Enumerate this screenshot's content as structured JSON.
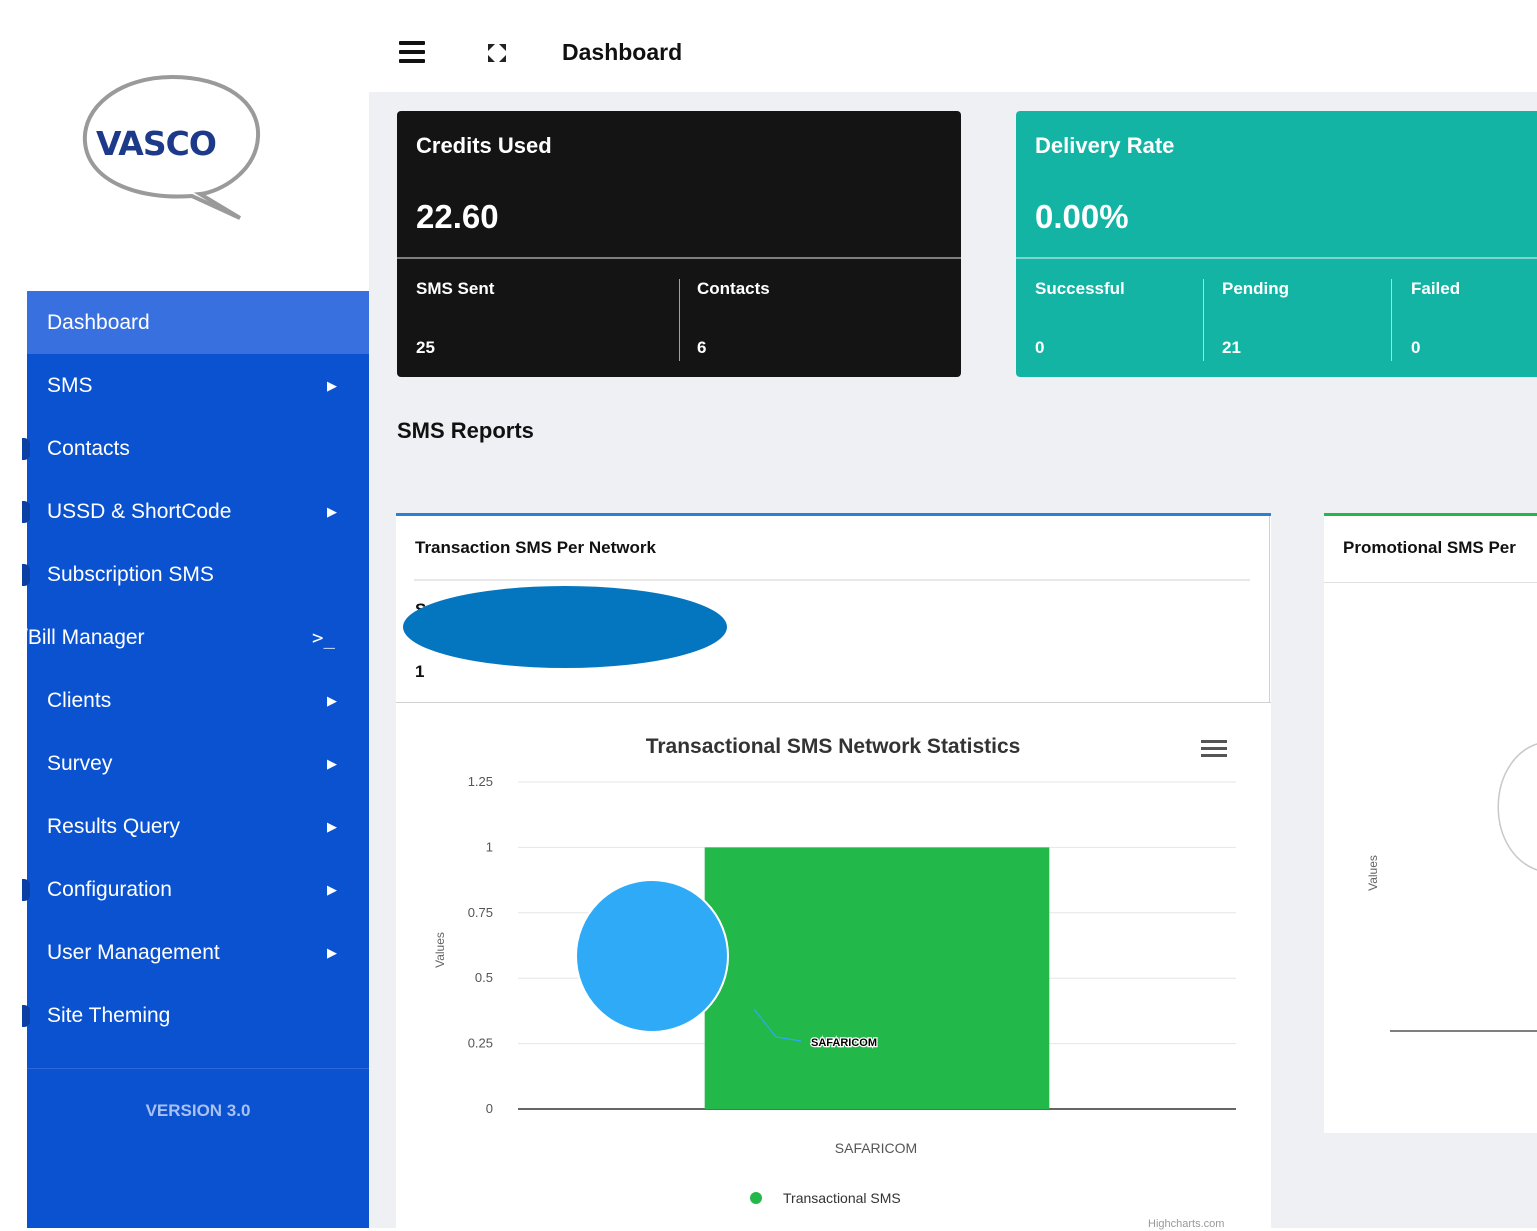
{
  "brand": {
    "logo_text": "VASCO"
  },
  "sidebar": {
    "items": [
      {
        "label": "Dashboard",
        "active": true,
        "arrow": ""
      },
      {
        "label": "SMS",
        "arrow": "▶"
      },
      {
        "label": "Contacts",
        "arrow": ""
      },
      {
        "label": "USSD & ShortCode",
        "arrow": "▶"
      },
      {
        "label": "Subscription SMS",
        "arrow": ""
      },
      {
        "label": "/Bill Manager",
        "arrow": "",
        "prompt": ">_"
      },
      {
        "label": "Clients",
        "arrow": "▶"
      },
      {
        "label": "Survey",
        "arrow": "▶"
      },
      {
        "label": "Results Query",
        "arrow": "▶"
      },
      {
        "label": "Configuration",
        "arrow": "▶"
      },
      {
        "label": "User Management",
        "arrow": "▶"
      },
      {
        "label": "Site Theming",
        "arrow": ""
      }
    ],
    "version": "VERSION 3.0"
  },
  "header": {
    "title": "Dashboard"
  },
  "credits_card": {
    "title": "Credits Used",
    "value": "22.60",
    "sms_sent_label": "SMS Sent",
    "sms_sent_value": "25",
    "contacts_label": "Contacts",
    "contacts_value": "6",
    "bg_color": "#141414"
  },
  "delivery_card": {
    "title": "Delivery Rate",
    "value": "0.00%",
    "successful_label": "Successful",
    "successful_value": "0",
    "pending_label": "Pending",
    "pending_value": "21",
    "failed_label": "Failed",
    "failed_value": "0",
    "bg_color": "#13b4a4"
  },
  "reports": {
    "section_title": "SMS Reports",
    "transaction_panel": {
      "title": "Transaction SMS Per Network",
      "count_text": "1",
      "partial_char": "S"
    },
    "promotional_panel": {
      "title": "Promotional SMS Per",
      "values_label": "Values"
    }
  },
  "chart_data": {
    "type": "bar",
    "title": "Transactional SMS Network Statistics",
    "categories": [
      "SAFARICOM"
    ],
    "series": [
      {
        "name": "Transactional SMS",
        "values": [
          1
        ],
        "color": "#22b84a"
      }
    ],
    "ylabel": "Values",
    "xlabel": "",
    "ylim": [
      0,
      1.25
    ],
    "yticks": [
      0,
      0.25,
      0.5,
      0.75,
      1,
      1.25
    ],
    "tick_labels": [
      "0",
      "0.25",
      "0.5",
      "0.75",
      "1",
      "1.25"
    ],
    "bubble_label": "SAFARICOM",
    "legend": "bottom-center",
    "credits": "Highcharts.com"
  }
}
